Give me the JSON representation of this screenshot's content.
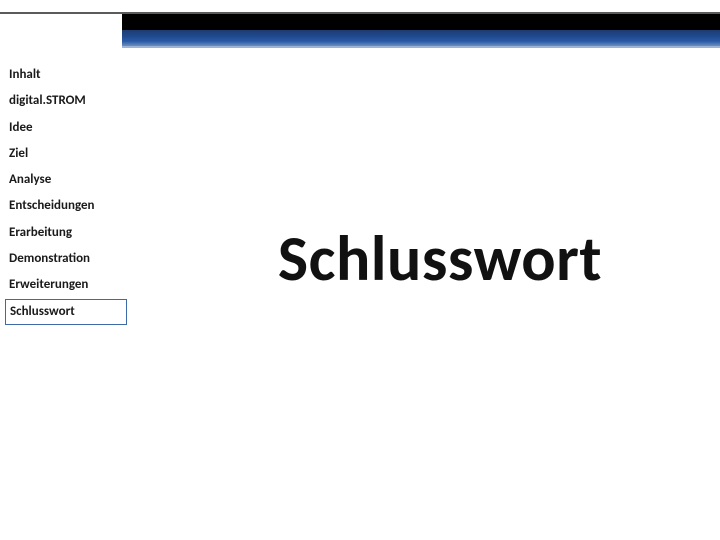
{
  "header": {
    "colors": {
      "black_bar": "#000000",
      "blue_bar_top": "#1f3b73",
      "blue_bar_bottom": "#6b8fbe"
    }
  },
  "nav": {
    "items": [
      {
        "label": "Inhalt"
      },
      {
        "label": "digital.STROM"
      },
      {
        "label": "Idee"
      },
      {
        "label": "Ziel"
      },
      {
        "label": "Analyse"
      },
      {
        "label": "Entscheidungen"
      },
      {
        "label": "Erarbeitung"
      },
      {
        "label": "Demonstration"
      },
      {
        "label": "Erweiterungen"
      },
      {
        "label": "Schlusswort"
      }
    ],
    "active_index": 9
  },
  "main": {
    "title": "Schlusswort"
  }
}
